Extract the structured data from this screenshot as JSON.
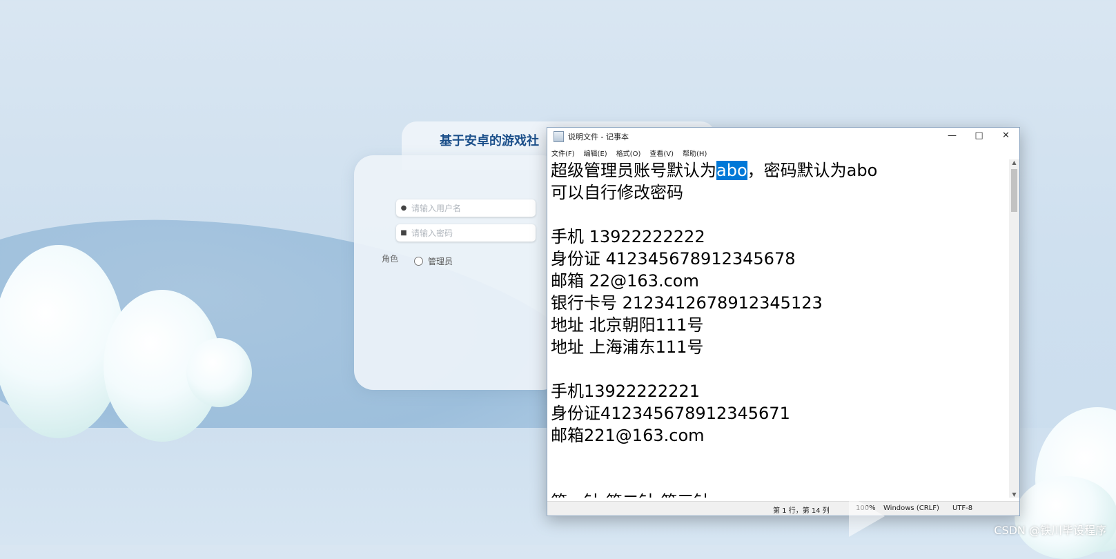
{
  "login": {
    "title": "基于安卓的游戏社",
    "username_placeholder": "请输入用户名",
    "password_placeholder": "请输入密码",
    "role_label": "角色",
    "role_option": "管理员"
  },
  "notepad": {
    "title": "说明文件 - 记事本",
    "menu": [
      "文件(F)",
      "编辑(E)",
      "格式(O)",
      "查看(V)",
      "帮助(H)"
    ],
    "line1_before": "超级管理员账号默认为",
    "line1_selected": "abo",
    "line1_after": "，密码默认为abo",
    "lines": [
      "可以自行修改密码",
      "",
      "手机 13922222222",
      "身份证 412345678912345678",
      "邮箱 22@163.com",
      "银行卡号 2123412678912345123",
      "地址 北京朝阳111号",
      "地址 上海浦东111号",
      "",
      "手机13922222221",
      "身份证412345678912345671",
      "邮箱221@163.com",
      "",
      "",
      "第一针 第二针 第三针"
    ],
    "status": {
      "position": "第 1 行，第 14 列",
      "zoom": "100%",
      "line_ending": "Windows (CRLF)",
      "encoding": "UTF-8"
    }
  },
  "watermark": "CSDN @铁川毕设程序"
}
